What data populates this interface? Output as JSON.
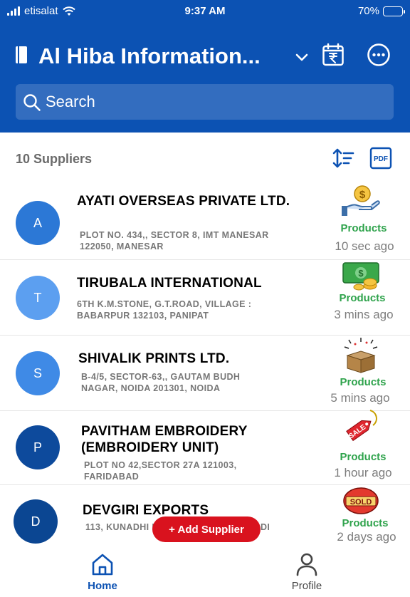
{
  "status_bar": {
    "carrier": "etisalat",
    "time": "9:37 AM",
    "battery": "70%",
    "battery_level": 0.7
  },
  "header": {
    "title": "Al Hiba Information...",
    "search_placeholder": "Search",
    "icons": [
      "book-icon",
      "chevron-down-icon",
      "rupee-calendar-icon",
      "more-options-icon",
      "search-icon"
    ]
  },
  "toolbar": {
    "count_label": "10 Suppliers",
    "icons": [
      "sort-icon",
      "pdf-icon"
    ]
  },
  "suppliers": [
    {
      "initial": "A",
      "name": "AYATI OVERSEAS PRIVATE LTD.",
      "address": "PLOT NO. 434,, SECTOR 8, IMT MANESAR 122050, MANESAR",
      "products_label": "Products",
      "updated": "10 sec ago",
      "product_icon": "money-hand-icon",
      "avatar_color": "#2c78d6"
    },
    {
      "initial": "T",
      "name": "TIRUBALA INTERNATIONAL",
      "address": "6TH K.M.STONE, G.T.ROAD, VILLAGE : BABARPUR 132103, PANIPAT",
      "products_label": "Products",
      "updated": "3 mins ago",
      "product_icon": "cash-coins-icon",
      "avatar_color": "#5c9ff0"
    },
    {
      "initial": "S",
      "name": "SHIVALIK PRINTS LTD.",
      "address": "B-4/5, SECTOR-63,, GAUTAM BUDH NAGAR, NOIDA 201301, NOIDA",
      "products_label": "Products",
      "updated": "5 mins ago",
      "product_icon": "open-box-icon",
      "avatar_color": "#3f8ae6"
    },
    {
      "initial": "P",
      "name": "PAVITHAM EMBROIDERY (EMBROIDERY UNIT)",
      "address": "PLOT NO 42,SECTOR 27A 121003, FARIDABAD",
      "products_label": "Products",
      "updated": "1 hour ago",
      "product_icon": "sale-tag-icon",
      "avatar_color": "#0d4a9c"
    },
    {
      "initial": "D",
      "name": "DEVGIRI EXPORTS",
      "address": "113, KUNADHI ROAD, GORIM",
      "address_tail": "DI",
      "products_label": "Products",
      "updated": "2 days ago",
      "product_icon": "sold-stamp-icon",
      "avatar_color": "#0b4692"
    }
  ],
  "fab": {
    "label": "+ Add Supplier"
  },
  "bottom_nav": {
    "items": [
      {
        "label": "Home",
        "icon": "home-icon",
        "active": true
      },
      {
        "label": "Profile",
        "icon": "profile-icon",
        "active": false
      }
    ]
  },
  "colors": {
    "primary": "#0c52b3",
    "products_green": "#2fa34c",
    "fab_red": "#d9121e"
  }
}
